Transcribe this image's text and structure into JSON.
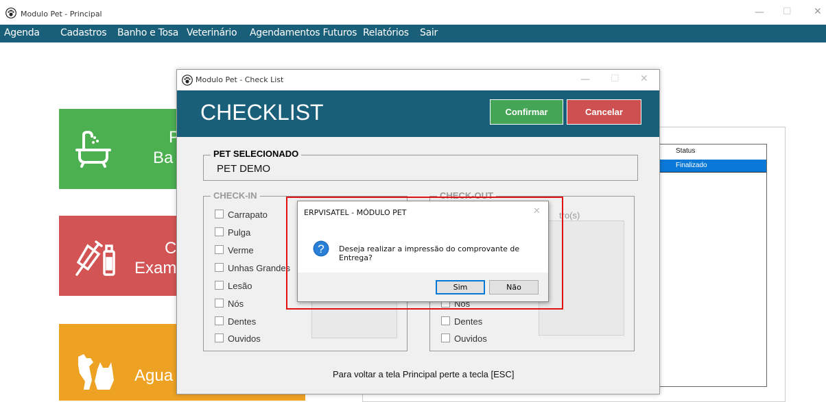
{
  "main_window": {
    "title": "Modulo Pet - Principal",
    "controls": {
      "minimize": "—",
      "maximize": "☐",
      "close": "✕"
    }
  },
  "menu": [
    "Agenda",
    "Cadastros",
    "Banho e Tosa",
    "Veterinário",
    "Agendamentos Futuros",
    "Relatórios",
    "Sair"
  ],
  "tiles": [
    {
      "line1": "P",
      "line2": "Ba",
      "color": "#4caf50",
      "icon": "bathtub-icon"
    },
    {
      "line1": "C",
      "line2": "Exam",
      "color": "#d35454",
      "icon": "vaccine-icon"
    },
    {
      "line1": "",
      "line2": "Agua",
      "color": "#eea224",
      "icon": "dog-cat-icon"
    }
  ],
  "grid": {
    "header": "Status",
    "row_value": "Finalizado"
  },
  "checklist": {
    "window_title": "Modulo Pet - Check List",
    "heading": "CHECKLIST",
    "confirm_label": "Confirmar",
    "cancel_label": "Cancelar",
    "pet_group_title": "PET SELECIONADO",
    "pet_name": "PET DEMO",
    "checkin_title": "CHECK-IN",
    "checkout_title": "CHECK-OUT",
    "checkin_items": [
      "Carrapato",
      "Pulga",
      "Verme",
      "Unhas Grandes",
      "Lesão",
      "Nós",
      "Dentes",
      "Ouvidos"
    ],
    "checkout_visible_items": [
      "Nós",
      "Dentes",
      "Ouvidos"
    ],
    "checkout_partial_label": "tro(s)",
    "footer_text": "Para voltar a tela Principal perte a tecla [ESC]"
  },
  "dialog": {
    "title": "ERPVISATEL - MÓDULO PET",
    "message": "Deseja realizar a impressão do comprovante de Entrega?",
    "yes_label": "Sim",
    "no_label": "Não",
    "icon": "question-icon"
  },
  "colors": {
    "header_teal": "#1a5f7a",
    "confirm_green": "#44a556",
    "cancel_red": "#cf5050",
    "selection_blue": "#0a78d7",
    "highlight_red": "#e01010"
  }
}
